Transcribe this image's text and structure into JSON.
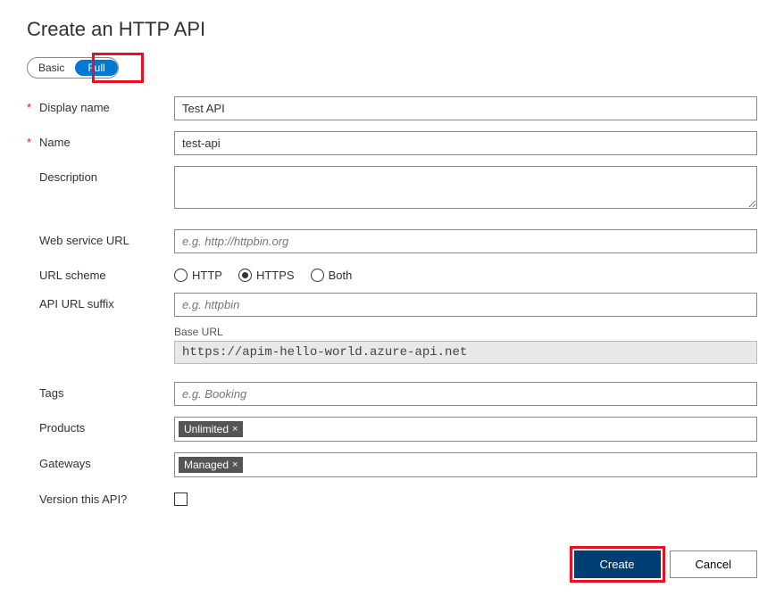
{
  "title": "Create an HTTP API",
  "toggle": {
    "basic": "Basic",
    "full": "Full"
  },
  "fields": {
    "displayName": {
      "label": "Display name",
      "value": "Test API"
    },
    "name": {
      "label": "Name",
      "value": "test-api"
    },
    "description": {
      "label": "Description",
      "value": ""
    },
    "webServiceUrl": {
      "label": "Web service URL",
      "placeholder": "e.g. http://httpbin.org",
      "value": ""
    },
    "urlScheme": {
      "label": "URL scheme",
      "options": {
        "http": "HTTP",
        "https": "HTTPS",
        "both": "Both"
      },
      "selected": "https"
    },
    "apiUrlSuffix": {
      "label": "API URL suffix",
      "placeholder": "e.g. httpbin",
      "value": ""
    },
    "baseUrl": {
      "label": "Base URL",
      "value": "https://apim-hello-world.azure-api.net"
    },
    "tags": {
      "label": "Tags",
      "placeholder": "e.g. Booking",
      "value": ""
    },
    "products": {
      "label": "Products",
      "chip": "Unlimited"
    },
    "gateways": {
      "label": "Gateways",
      "chip": "Managed"
    },
    "versionThisApi": {
      "label": "Version this API?"
    }
  },
  "buttons": {
    "create": "Create",
    "cancel": "Cancel"
  },
  "chipClose": "×"
}
